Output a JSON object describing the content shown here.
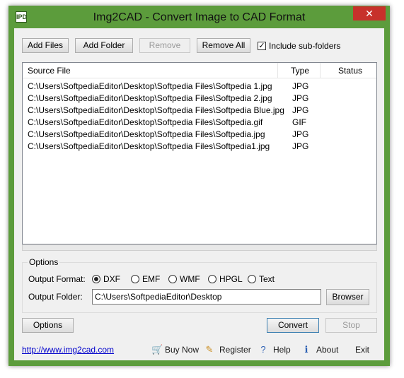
{
  "window": {
    "title": "Img2CAD - Convert Image to CAD Format",
    "icon_text": "IPD",
    "close_glyph": "✕"
  },
  "toolbar": {
    "add_files": "Add Files",
    "add_folder": "Add Folder",
    "remove": "Remove",
    "remove_all": "Remove All",
    "include_subfolders": "Include sub-folders",
    "include_subfolders_checked": true
  },
  "file_list": {
    "columns": [
      "Source File",
      "Type",
      "Status"
    ],
    "rows": [
      {
        "path": "C:\\Users\\SoftpediaEditor\\Desktop\\Softpedia Files\\Softpedia 1.jpg",
        "type": "JPG",
        "status": ""
      },
      {
        "path": "C:\\Users\\SoftpediaEditor\\Desktop\\Softpedia Files\\Softpedia 2.jpg",
        "type": "JPG",
        "status": ""
      },
      {
        "path": "C:\\Users\\SoftpediaEditor\\Desktop\\Softpedia Files\\Softpedia Blue.jpg",
        "type": "JPG",
        "status": ""
      },
      {
        "path": "C:\\Users\\SoftpediaEditor\\Desktop\\Softpedia Files\\Softpedia.gif",
        "type": "GIF",
        "status": ""
      },
      {
        "path": "C:\\Users\\SoftpediaEditor\\Desktop\\Softpedia Files\\Softpedia.jpg",
        "type": "JPG",
        "status": ""
      },
      {
        "path": "C:\\Users\\SoftpediaEditor\\Desktop\\Softpedia Files\\Softpedia1.jpg",
        "type": "JPG",
        "status": ""
      }
    ]
  },
  "options": {
    "group_label": "Options",
    "output_format_label": "Output Format:",
    "formats": [
      "DXF",
      "EMF",
      "WMF",
      "HPGL",
      "Text"
    ],
    "selected_format": "DXF",
    "output_folder_label": "Output Folder:",
    "output_folder_value": "C:\\Users\\SoftpediaEditor\\Desktop",
    "browse_label": "Browser"
  },
  "actions": {
    "options": "Options",
    "convert": "Convert",
    "stop": "Stop"
  },
  "footer": {
    "url": "http://www.img2cad.com",
    "buy_now": "Buy Now",
    "register": "Register",
    "help": "Help",
    "about": "About",
    "exit": "Exit"
  },
  "colors": {
    "title_bar": "#5c9c3c",
    "close_button": "#c7312b",
    "link": "#0000cc"
  }
}
